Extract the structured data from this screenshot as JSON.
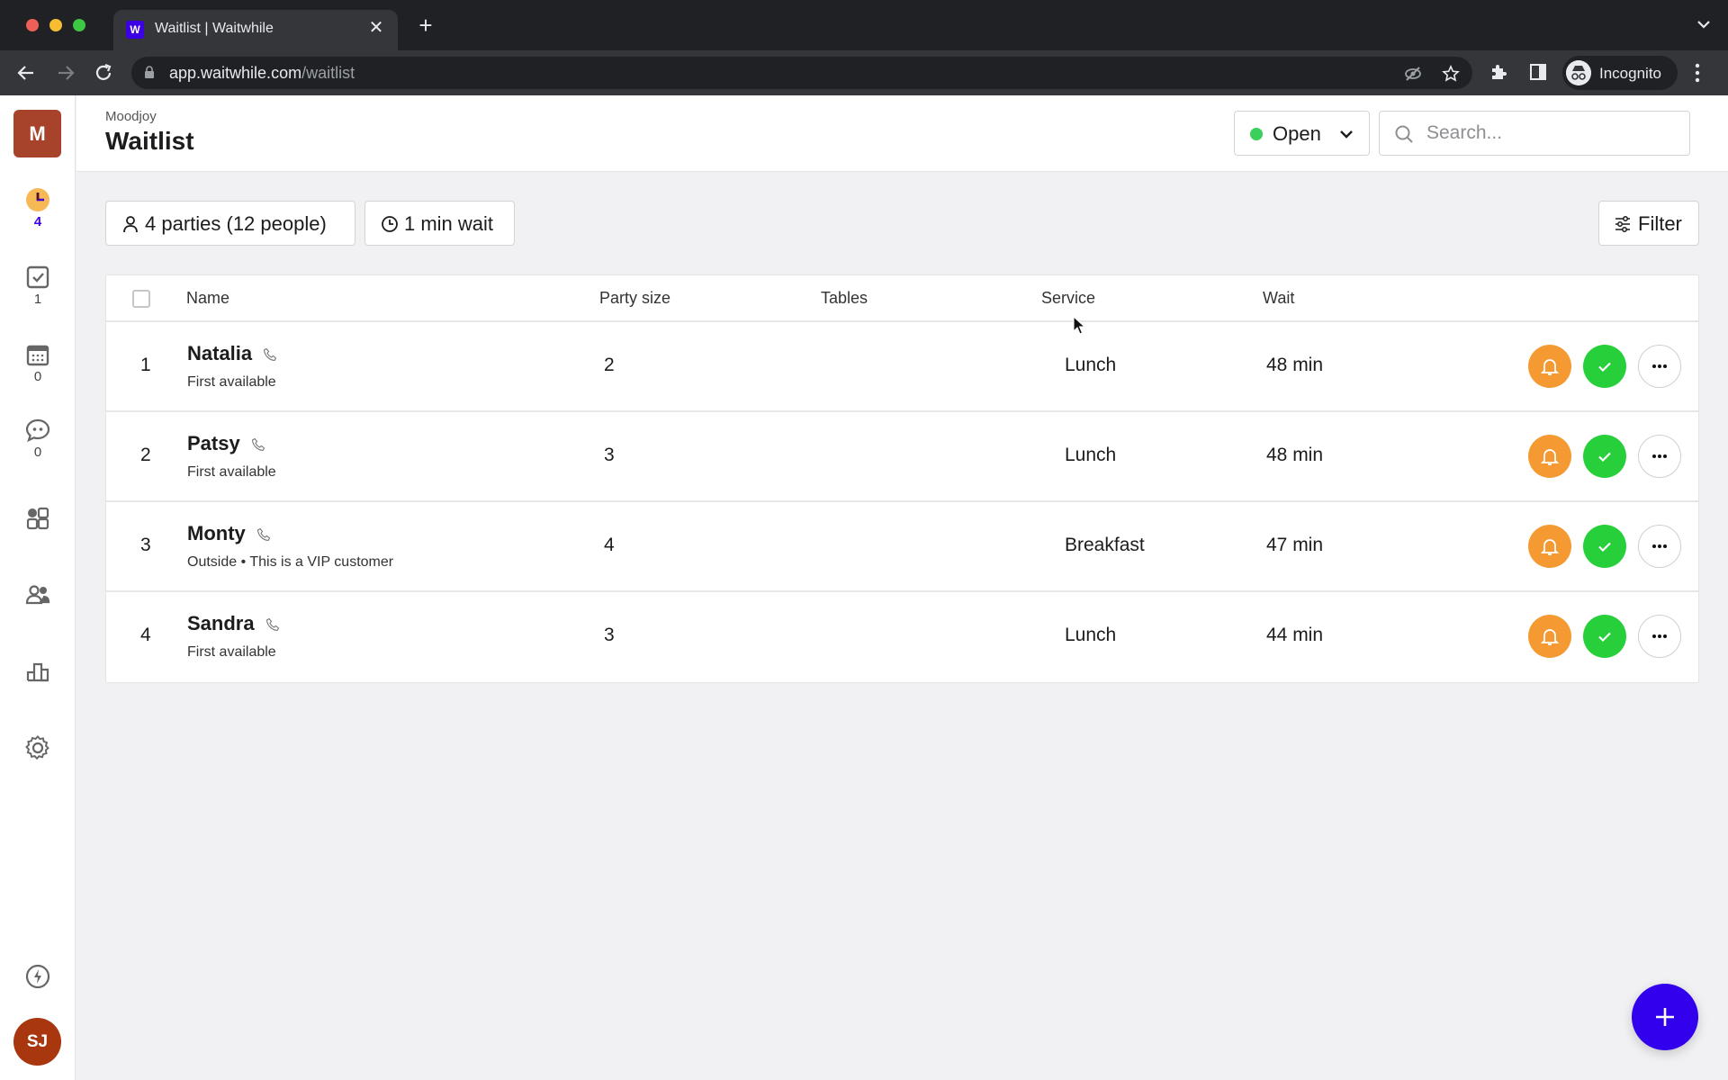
{
  "browser": {
    "tab_title": "Waitlist | Waitwhile",
    "favicon_letter": "W",
    "url_host": "app.waitwhile.com",
    "url_path": "/waitlist",
    "profile_label": "Incognito"
  },
  "sidebar": {
    "org_initial": "M",
    "items": [
      {
        "icon": "clock-icon",
        "count": "4",
        "active": true
      },
      {
        "icon": "checkbox-icon",
        "count": "1"
      },
      {
        "icon": "calendar-icon",
        "count": "0"
      },
      {
        "icon": "chat-icon",
        "count": "0"
      },
      {
        "icon": "apps-icon"
      },
      {
        "icon": "customers-icon"
      },
      {
        "icon": "analytics-icon"
      },
      {
        "icon": "gear-icon"
      }
    ],
    "bottom": {
      "icon": "bolt-icon"
    },
    "user_initials": "SJ"
  },
  "header": {
    "org_name": "Moodjoy",
    "title": "Waitlist",
    "status": {
      "label": "Open",
      "color": "#3ad05b"
    },
    "search_placeholder": "Search..."
  },
  "summary": {
    "parties": "4 parties (12 people)",
    "wait": "1 min wait",
    "filter_label": "Filter"
  },
  "table": {
    "columns": [
      "Name",
      "Party size",
      "Tables",
      "Service",
      "Wait"
    ],
    "rows": [
      {
        "position": "1",
        "name": "Natalia",
        "note": "First available",
        "party_size": "2",
        "tables": "",
        "service": "Lunch",
        "wait": "48 min"
      },
      {
        "position": "2",
        "name": "Patsy",
        "note": "First available",
        "party_size": "3",
        "tables": "",
        "service": "Lunch",
        "wait": "48 min"
      },
      {
        "position": "3",
        "name": "Monty",
        "note": "Outside  • This is a VIP customer",
        "party_size": "4",
        "tables": "",
        "service": "Breakfast",
        "wait": "47 min"
      },
      {
        "position": "4",
        "name": "Sandra",
        "note": "First available",
        "party_size": "3",
        "tables": "",
        "service": "Lunch",
        "wait": "44 min"
      }
    ]
  },
  "colors": {
    "brand": "#3300ee",
    "notify": "#f59a32",
    "seat": "#27cf3a",
    "org_badge": "#a8432b",
    "user_avatar": "#a8360f"
  }
}
